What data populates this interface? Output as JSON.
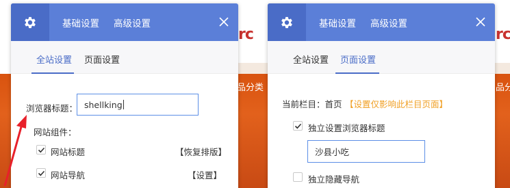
{
  "background": {
    "logo_fragment": "rc",
    "category_fragment": "品分类"
  },
  "left_panel": {
    "header_tabs": [
      "基础设置",
      "高级设置"
    ],
    "sub_tabs": [
      "全站设置",
      "页面设置"
    ],
    "active_sub_tab": "全站设置",
    "browser_title_label": "浏览器标题：",
    "browser_title_value": "shellking",
    "site_components_label": "网站组件：",
    "components": [
      {
        "label": "网站标题",
        "checked": true,
        "action": "【恢复排版】"
      },
      {
        "label": "网站导航",
        "checked": true,
        "action": "【设置】"
      }
    ]
  },
  "right_panel": {
    "header_tabs": [
      "基础设置",
      "高级设置"
    ],
    "sub_tabs": [
      "全站设置",
      "页面设置"
    ],
    "active_sub_tab": "页面设置",
    "current_column_label": "当前栏目：首页",
    "current_column_note": "【设置仅影响此栏目页面】",
    "independent_title": {
      "label": "独立设置浏览器标题",
      "checked": true
    },
    "independent_title_value": "沙县小吃",
    "hide_nav": {
      "label": "独立隐藏导航",
      "checked": false
    }
  },
  "colors": {
    "header_blue": "#5b7fd8",
    "accent_blue": "#4a6cc7",
    "note_orange": "#f0a026",
    "annotation_red": "#e8202a"
  }
}
